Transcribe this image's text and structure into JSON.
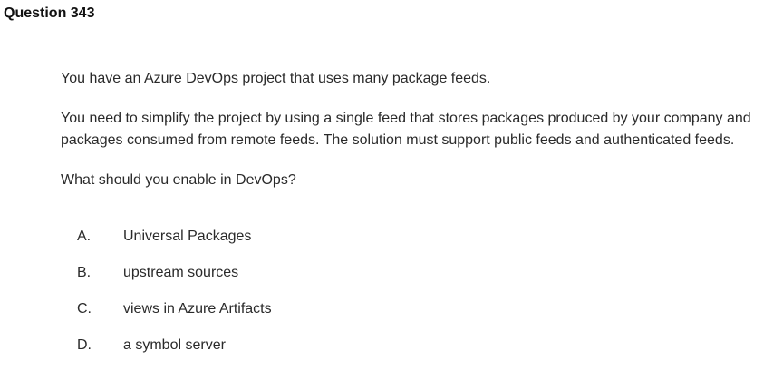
{
  "question": {
    "title": "Question 343",
    "paragraphs": [
      "You have an Azure DevOps project that uses many package feeds.",
      "You need to simplify the project by using a single feed that stores packages produced by your company and packages consumed from remote feeds. The solution must support public feeds and authenticated feeds.",
      "What should you enable in DevOps?"
    ]
  },
  "options": [
    {
      "letter": "A.",
      "text": "Universal Packages"
    },
    {
      "letter": "B.",
      "text": "upstream sources"
    },
    {
      "letter": "C.",
      "text": "views in Azure Artifacts"
    },
    {
      "letter": "D.",
      "text": "a symbol server"
    }
  ]
}
